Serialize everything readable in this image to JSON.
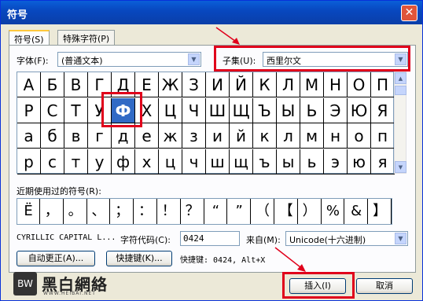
{
  "window": {
    "title": "符号",
    "close_label": "✕"
  },
  "tabs": [
    {
      "label": "符号(S)",
      "active": true
    },
    {
      "label": "特殊字符(P)",
      "active": false
    }
  ],
  "font": {
    "label": "字体(F):",
    "value": "(普通文本)"
  },
  "subset": {
    "label": "子集(U):",
    "value": "西里尔文"
  },
  "grid": {
    "rows": [
      [
        "А",
        "Б",
        "В",
        "Г",
        "Д",
        "Е",
        "Ж",
        "З",
        "И",
        "Й",
        "К",
        "Л",
        "М",
        "Н",
        "О",
        "П"
      ],
      [
        "Р",
        "С",
        "Т",
        "У",
        "Ф",
        "Х",
        "Ц",
        "Ч",
        "Ш",
        "Щ",
        "Ъ",
        "Ы",
        "Ь",
        "Э",
        "Ю",
        "Я"
      ],
      [
        "а",
        "б",
        "в",
        "г",
        "д",
        "е",
        "ж",
        "з",
        "и",
        "й",
        "к",
        "л",
        "м",
        "н",
        "о",
        "п"
      ],
      [
        "р",
        "с",
        "т",
        "у",
        "ф",
        "х",
        "ц",
        "ч",
        "ш",
        "щ",
        "ъ",
        "ы",
        "ь",
        "э",
        "ю",
        "я"
      ]
    ],
    "selected": {
      "row": 1,
      "col": 4
    }
  },
  "recent": {
    "label": "近期使用过的符号(R):",
    "symbols": [
      "Ё",
      "，",
      "。",
      "、",
      "；",
      "：",
      "！",
      "？",
      "“",
      "”",
      "（",
      "【",
      "）",
      "%",
      "&",
      "】"
    ]
  },
  "char_name": "CYRILLIC CAPITAL L...",
  "char_code": {
    "label": "字符代码(C):",
    "value": "0424"
  },
  "from": {
    "label": "来自(M):",
    "value": "Unicode(十六进制)"
  },
  "buttons": {
    "autocorrect": "自动更正(A)...",
    "shortcut_key": "快捷键(K)...",
    "insert": "插入(I)",
    "cancel": "取消"
  },
  "shortcut_text": "快捷键: 0424, Alt+X",
  "watermark": {
    "brand": "黑白網絡",
    "url": "WWW.HEIBAI.NET",
    "mark": "BW"
  },
  "colors": {
    "highlight": "#e0001b",
    "selection": "#316ac5",
    "titlebar": "#0a5fd8"
  }
}
